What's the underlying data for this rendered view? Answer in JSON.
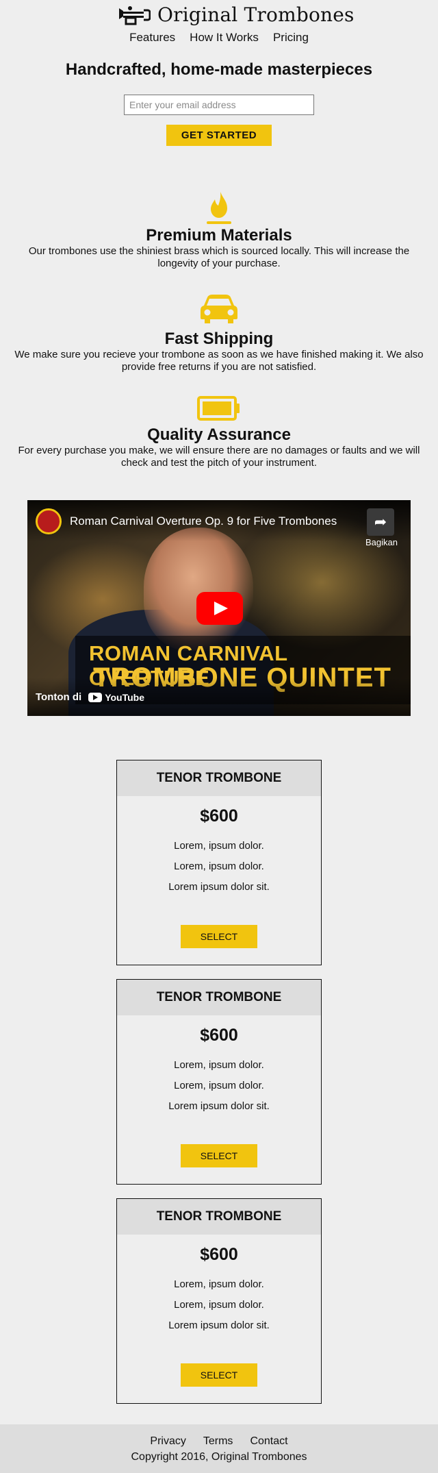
{
  "header": {
    "brand": "Original Trombones",
    "nav": [
      "Features",
      "How It Works",
      "Pricing"
    ]
  },
  "hero": {
    "title": "Handcrafted, home-made masterpieces",
    "email_placeholder": "Enter your email address",
    "cta_label": "GET STARTED"
  },
  "features": [
    {
      "icon": "fire-icon",
      "title": "Premium Materials",
      "text": "Our trombones use the shiniest brass which is sourced locally. This will increase the longevity of your purchase."
    },
    {
      "icon": "car-icon",
      "title": "Fast Shipping",
      "text": "We make sure you recieve your trombone as soon as we have finished making it. We also provide free returns if you are not satisfied."
    },
    {
      "icon": "battery-full-icon",
      "title": "Quality Assurance",
      "text": "For every purchase you make, we will ensure there are no damages or faults and we will check and test the pitch of your instrument."
    }
  ],
  "video": {
    "title": "Roman Carnival Overture Op. 9 for Five Trombones",
    "share_label": "Bagikan",
    "overlay_line1": "ROMAN CARNIVAL OVERTURE",
    "overlay_line2": "TROMBONE QUINTET",
    "watch_label": "Tonton di",
    "youtube_label": "YouTube"
  },
  "pricing": [
    {
      "name": "TENOR TROMBONE",
      "price": "$600",
      "features": [
        "Lorem, ipsum dolor.",
        "Lorem, ipsum dolor.",
        "Lorem ipsum dolor sit."
      ],
      "button": "SELECT"
    },
    {
      "name": "TENOR TROMBONE",
      "price": "$600",
      "features": [
        "Lorem, ipsum dolor.",
        "Lorem, ipsum dolor.",
        "Lorem ipsum dolor sit."
      ],
      "button": "SELECT"
    },
    {
      "name": "TENOR TROMBONE",
      "price": "$600",
      "features": [
        "Lorem, ipsum dolor.",
        "Lorem, ipsum dolor.",
        "Lorem ipsum dolor sit."
      ],
      "button": "SELECT"
    }
  ],
  "footer": {
    "links": [
      "Privacy",
      "Terms",
      "Contact"
    ],
    "copyright": "Copyright 2016, Original Trombones"
  },
  "colors": {
    "accent": "#f1c40f",
    "background": "#eeeeee",
    "panel": "#dddddd"
  }
}
